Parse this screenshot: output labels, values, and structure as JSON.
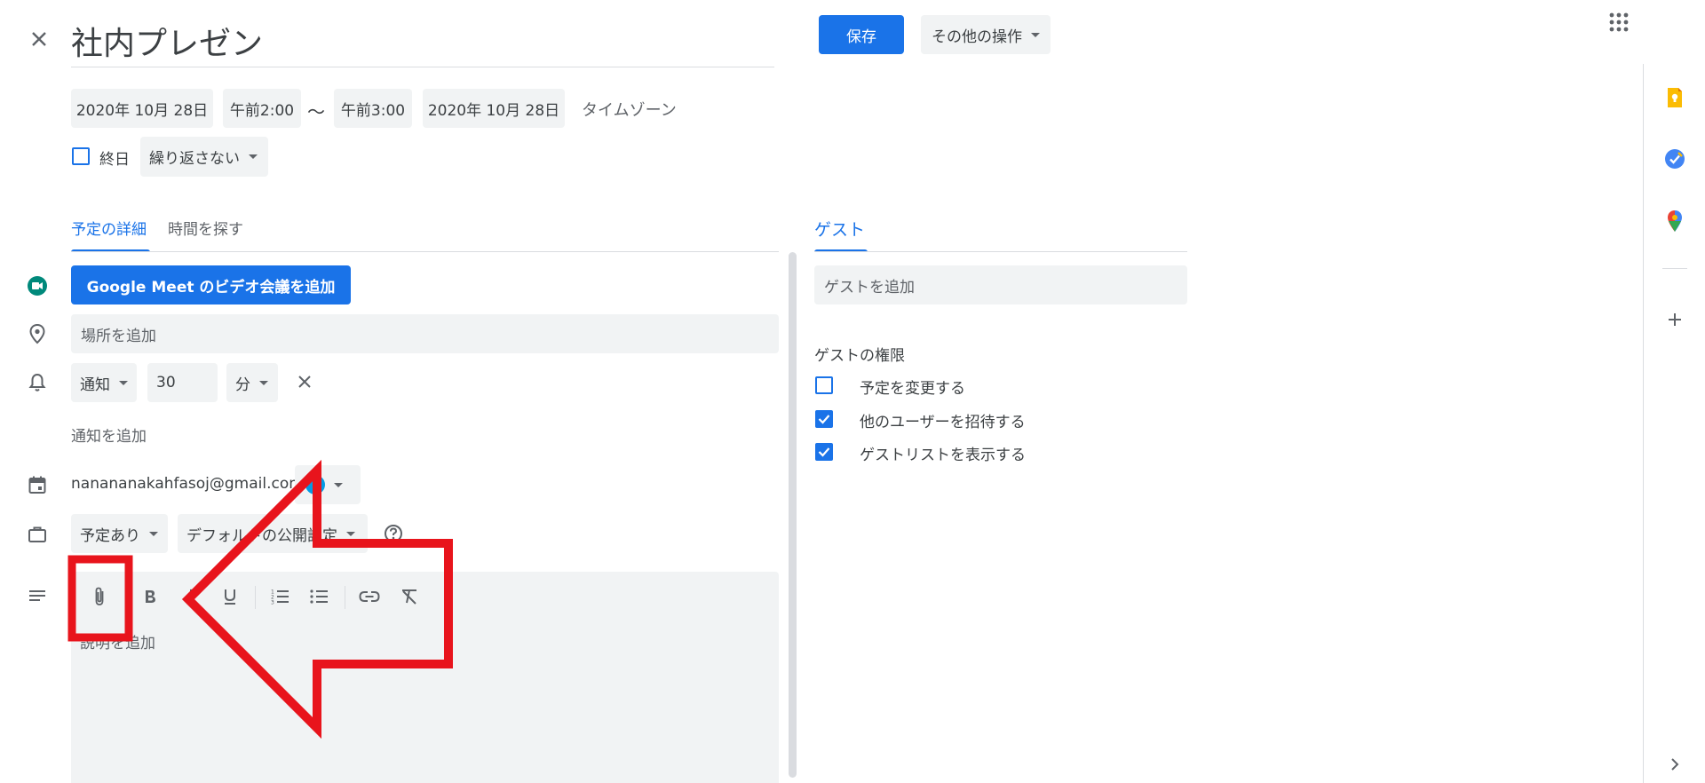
{
  "header": {
    "title": "社内プレゼン",
    "save_label": "保存",
    "more_actions_label": "その他の操作"
  },
  "datetime": {
    "start_date": "2020年 10月 28日",
    "start_time": "午前2:00",
    "separator": "～",
    "end_time": "午前3:00",
    "end_date": "2020年 10月 28日",
    "timezone_label": "タイムゾーン",
    "all_day_label": "終日",
    "repeat_label": "繰り返さない"
  },
  "tabs": {
    "details": "予定の詳細",
    "find_time": "時間を探す",
    "guests": "ゲスト"
  },
  "details": {
    "meet_button": "Google Meet のビデオ会議を追加",
    "location_placeholder": "場所を追加",
    "notification_type": "通知",
    "notification_value": "30",
    "notification_unit": "分",
    "add_notification": "通知を追加",
    "calendar_email": "nanananakahfasoj@gmail.com",
    "busy_status": "予定あり",
    "visibility": "デフォルトの公開設定",
    "description_placeholder": "説明を追加"
  },
  "guests": {
    "add_placeholder": "ゲストを追加",
    "permissions_title": "ゲストの権限",
    "permissions": [
      {
        "label": "予定を変更する",
        "checked": false
      },
      {
        "label": "他のユーザーを招待する",
        "checked": true
      },
      {
        "label": "ゲストリストを表示する",
        "checked": true
      }
    ]
  },
  "colors": {
    "accent": "#1a73e8",
    "field_bg": "#f1f3f4",
    "annotation_red": "#e8141c"
  }
}
